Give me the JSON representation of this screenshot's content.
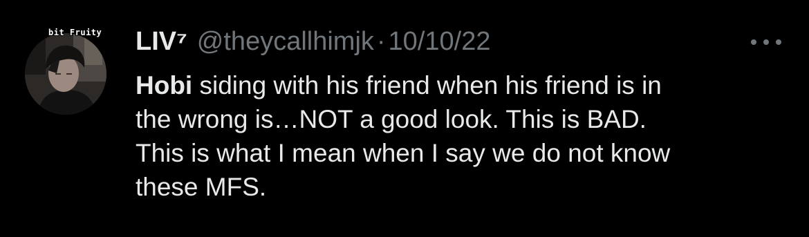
{
  "tweet": {
    "author": {
      "display_name": "LIV⁷",
      "handle": "@theycallhimjk",
      "avatar_badge_text": "bit Fruity"
    },
    "separator": "·",
    "timestamp": "10/10/22",
    "more_icon": "more-horizontal-icon",
    "text_lines": [
      {
        "bold": "Hobi",
        "rest": " siding with his friend when his friend is in"
      },
      {
        "text": "the wrong is…NOT a good look. This is BAD."
      },
      {
        "text": "This is what I mean when I say we do not know"
      },
      {
        "text": "these MFS."
      }
    ]
  },
  "colors": {
    "background": "#000000",
    "primary_text": "#e7e9ea",
    "secondary_text": "#71767b"
  }
}
